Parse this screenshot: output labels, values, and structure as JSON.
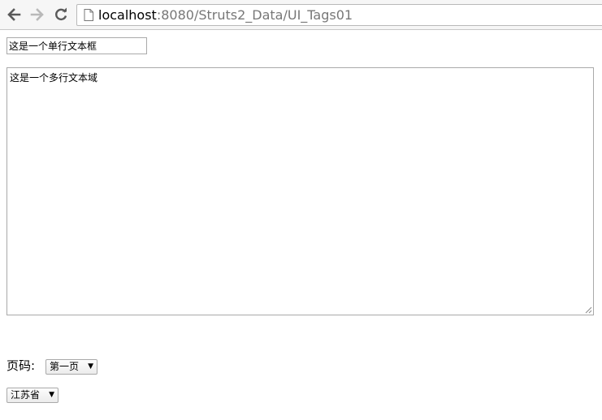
{
  "browser": {
    "url_host": "localhost",
    "url_rest": ":8080/Struts2_Data/UI_Tags01",
    "icons": [
      "back-arrow-icon",
      "forward-arrow-icon",
      "reload-icon",
      "page-icon"
    ]
  },
  "form": {
    "textfield_value": "这是一个单行文本框",
    "textarea_value": "这是一个多行文本域",
    "page_label": "页码:",
    "page_select_value": "第一页",
    "province_select_value": "江苏省",
    "dropdown_arrow": "▼"
  }
}
